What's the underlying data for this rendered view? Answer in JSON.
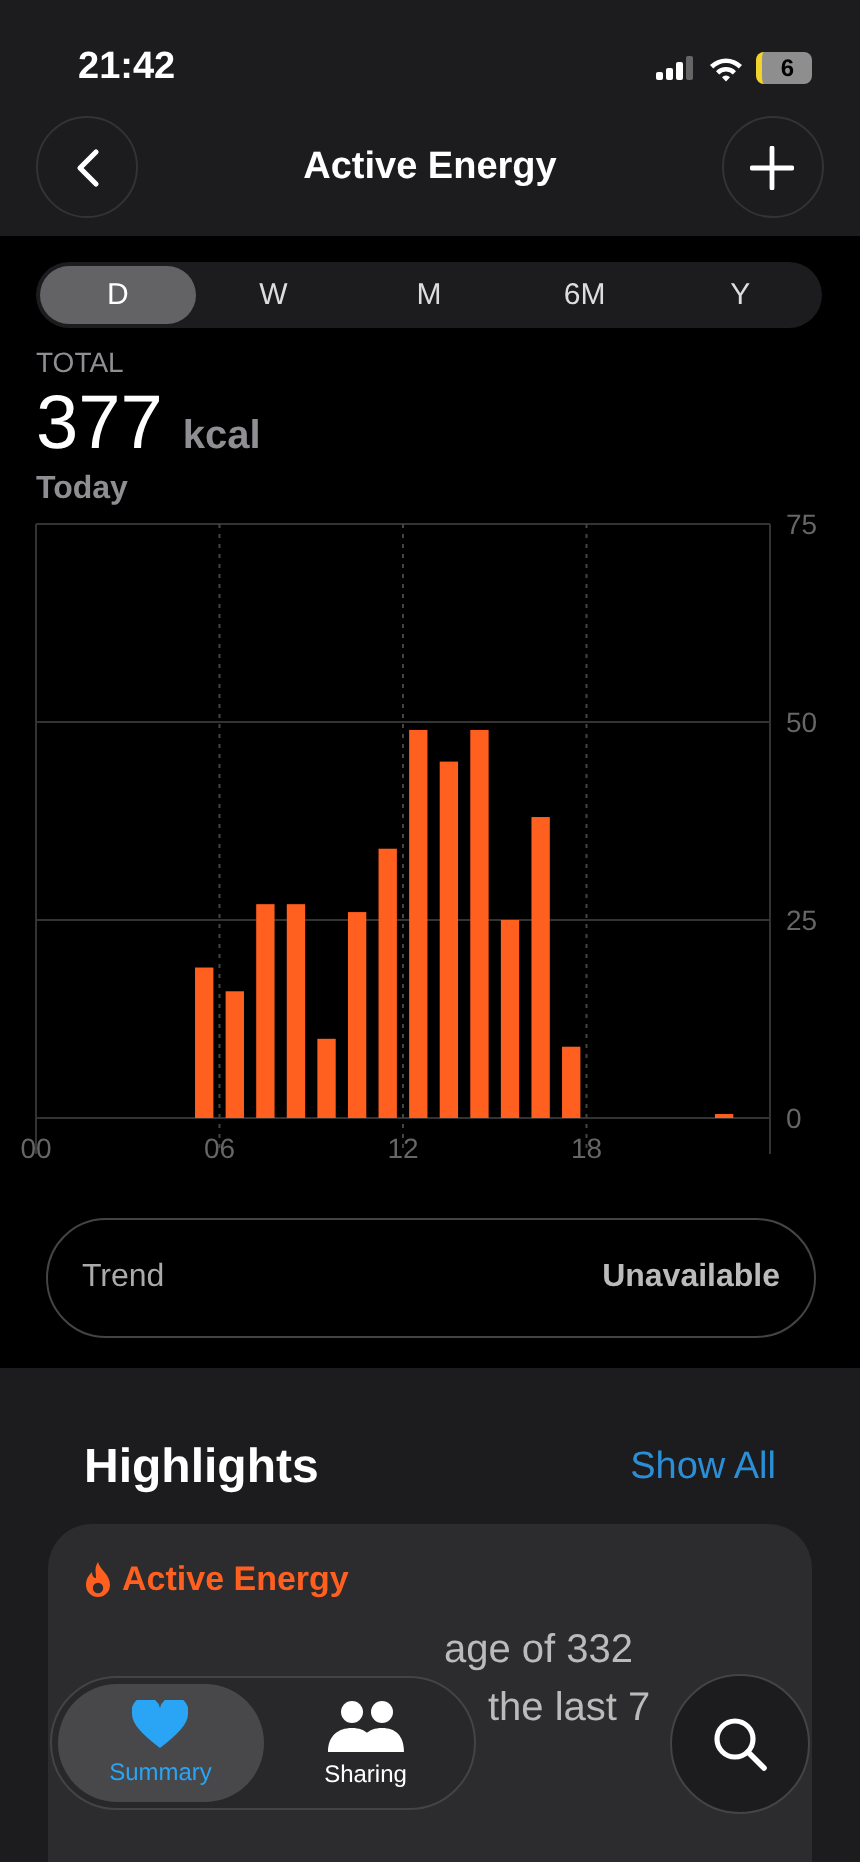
{
  "status_bar": {
    "time": "21:42",
    "battery": "6"
  },
  "nav": {
    "title": "Active Energy"
  },
  "segments": [
    {
      "label": "D",
      "selected": true
    },
    {
      "label": "W",
      "selected": false
    },
    {
      "label": "M",
      "selected": false
    },
    {
      "label": "6M",
      "selected": false
    },
    {
      "label": "Y",
      "selected": false
    }
  ],
  "summary": {
    "label": "TOTAL",
    "value": "377",
    "unit": "kcal",
    "period": "Today"
  },
  "chart_data": {
    "type": "bar",
    "x": [
      5.5,
      6.5,
      7.5,
      8.5,
      9.5,
      10.5,
      11.5,
      12.5,
      13.5,
      14.5,
      15.5,
      16.5,
      17.5,
      22.5
    ],
    "series": [
      {
        "color": "#ff5f1f",
        "values": [
          19,
          16,
          27,
          27,
          10,
          26,
          34,
          49,
          45,
          49,
          25,
          38,
          9,
          0.5
        ]
      }
    ],
    "xlim": [
      0,
      24
    ],
    "grid": true,
    "xticks": [
      {
        "value": 0,
        "label": "00"
      },
      {
        "value": 6,
        "label": "06"
      },
      {
        "value": 12,
        "label": "12"
      },
      {
        "value": 18,
        "label": "18"
      }
    ],
    "ylim": [
      0,
      75
    ],
    "yticks": [
      0,
      25,
      50,
      75
    ]
  },
  "trend": {
    "label": "Trend",
    "value": "Unavailable"
  },
  "highlights": {
    "title": "Highlights",
    "action": "Show All",
    "card": {
      "title": "Active Energy",
      "lines": [
        "age of 332",
        "the last 7"
      ]
    }
  },
  "tab_bar": {
    "tabs": [
      {
        "label": "Summary",
        "selected": true
      },
      {
        "label": "Sharing",
        "selected": false
      }
    ]
  }
}
